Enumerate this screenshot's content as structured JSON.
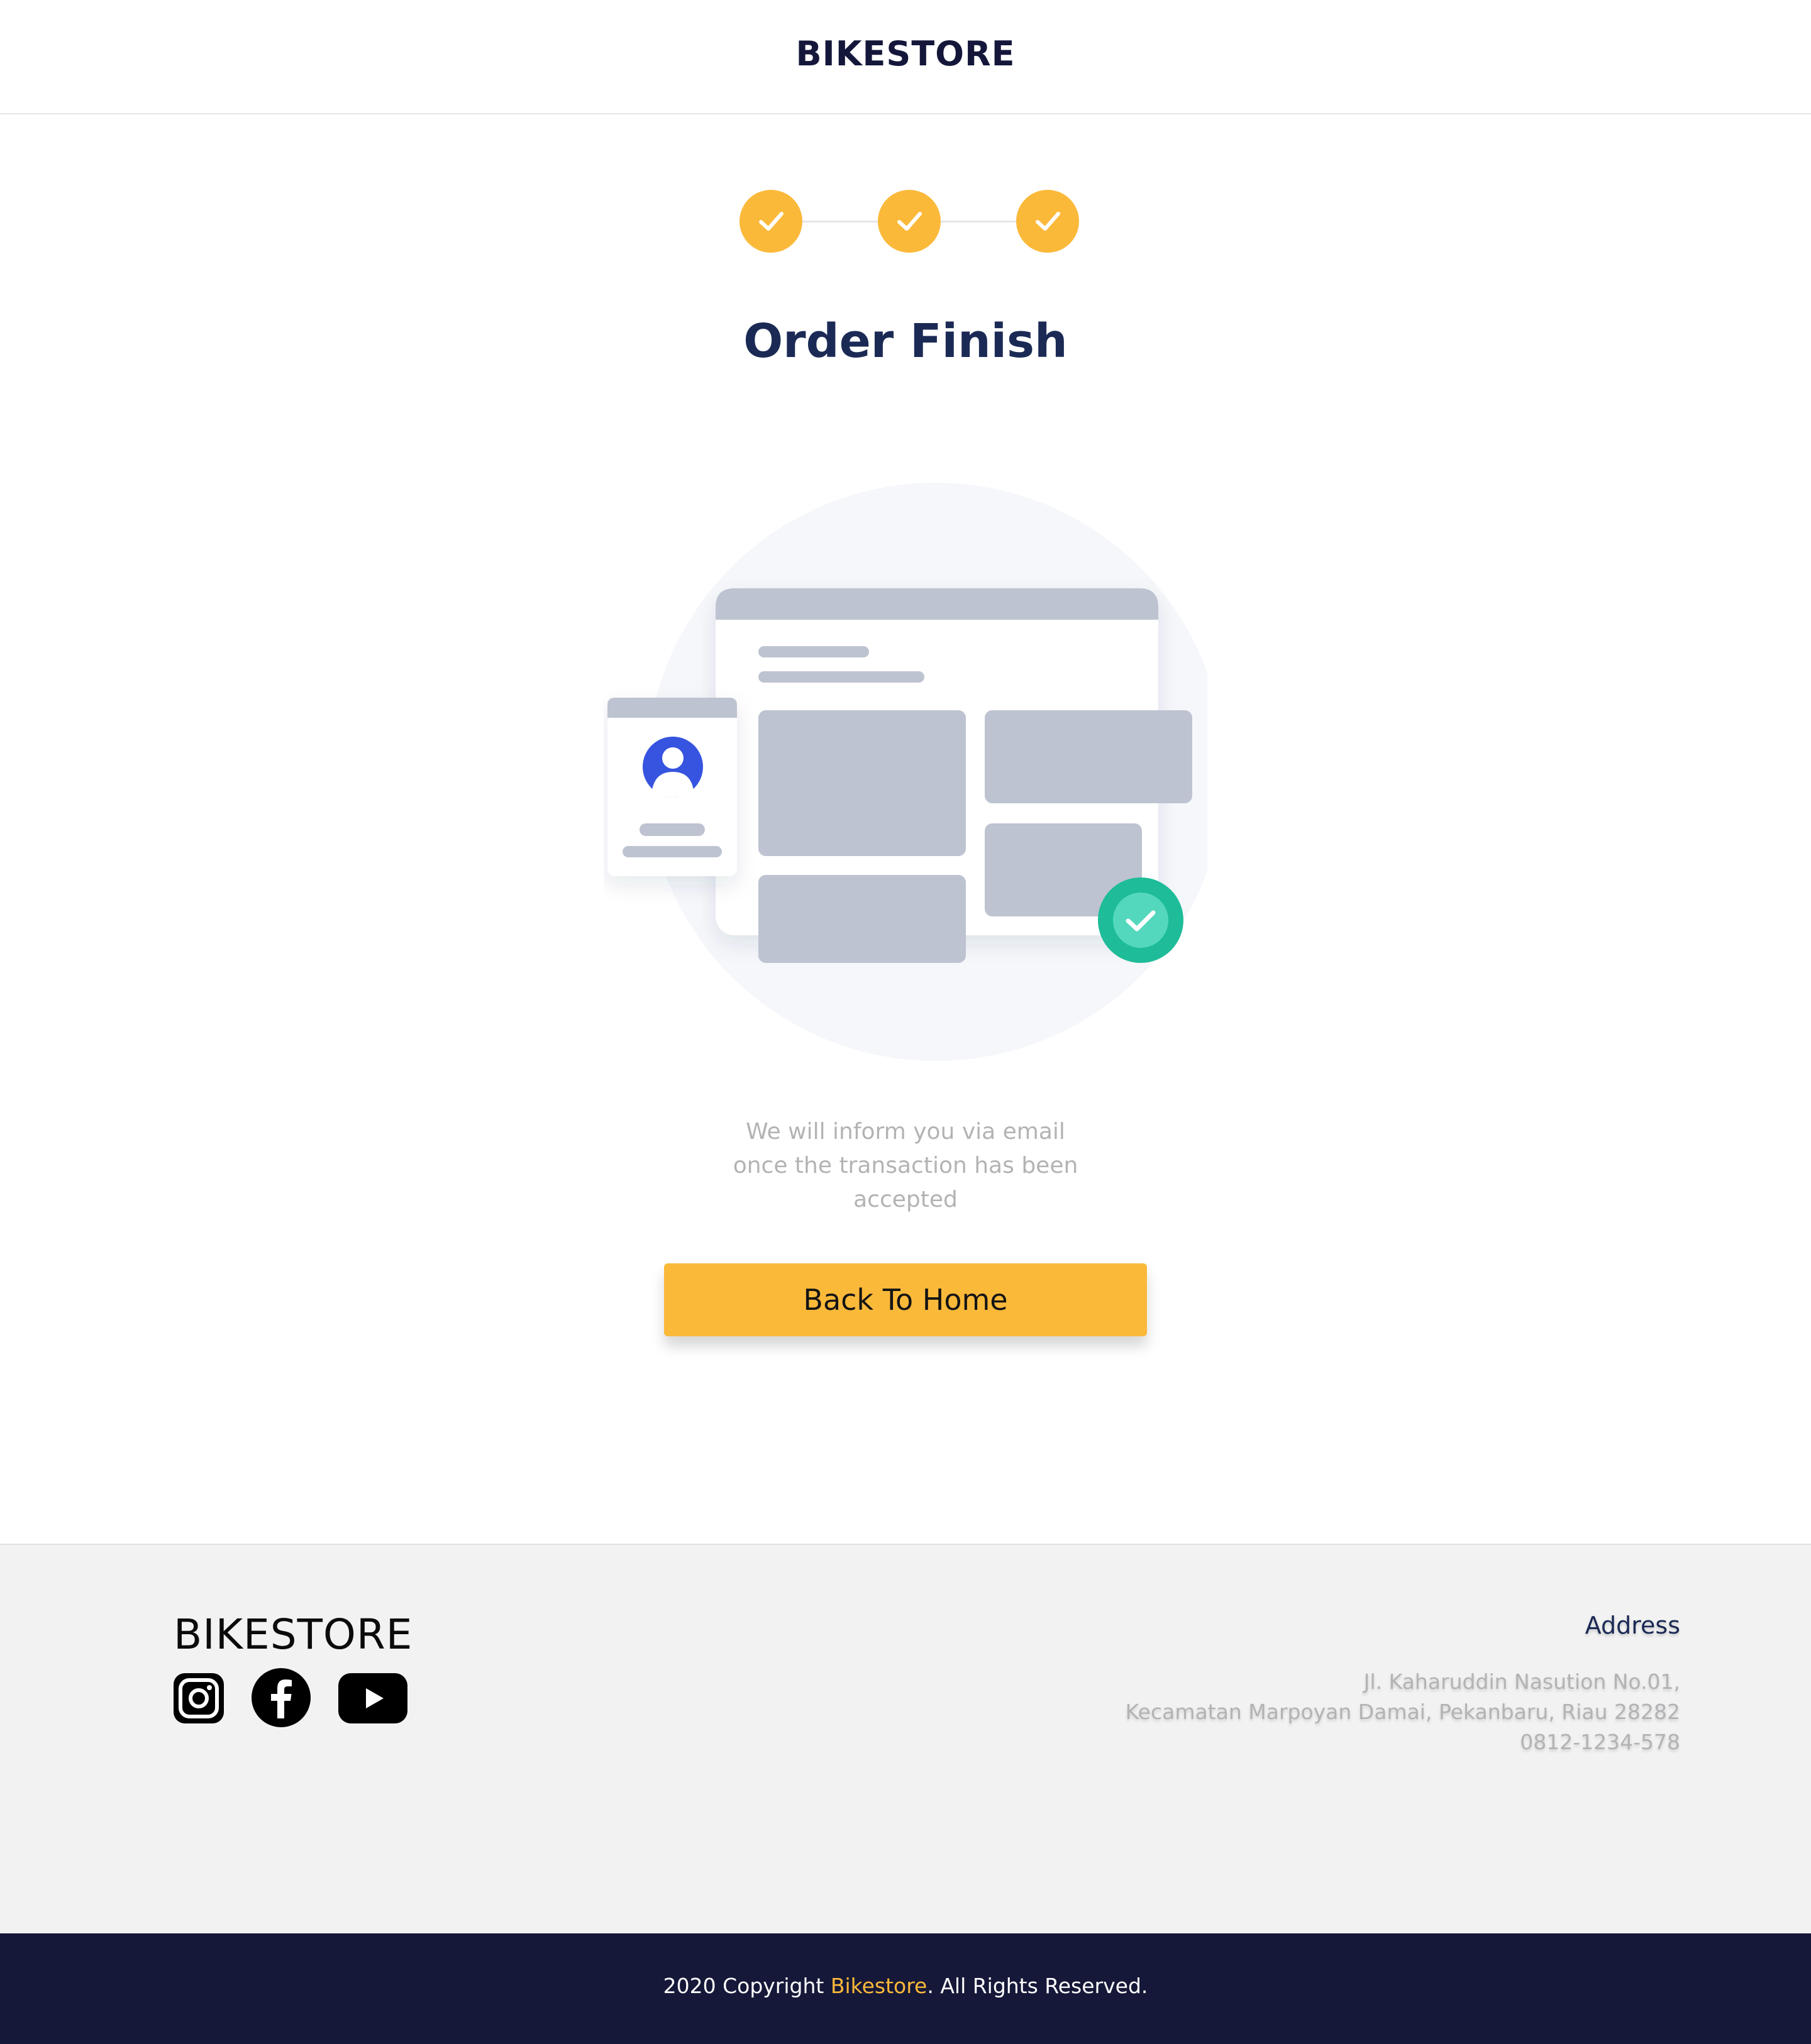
{
  "header": {
    "brand": "BIKESTORE"
  },
  "steps": [
    {
      "state": "done",
      "icon": "check-icon"
    },
    {
      "state": "done",
      "icon": "check-icon"
    },
    {
      "state": "done",
      "icon": "check-icon"
    }
  ],
  "main": {
    "title": "Order Finish",
    "message_lines": [
      "We will inform you via email",
      "once the transaction has been",
      "accepted"
    ],
    "back_button_label": "Back To Home",
    "illustration_icons": [
      "browser-window-icon",
      "user-card-icon",
      "success-check-icon"
    ]
  },
  "footer": {
    "brand": "BIKESTORE",
    "social_icons": [
      "instagram-icon",
      "facebook-icon",
      "youtube-icon"
    ],
    "address_title": "Address",
    "address_lines": [
      "Jl. Kaharuddin Nasution No.01,",
      "Kecamatan Marpoyan Damai, Pekanbaru, Riau 28282",
      "0812-1234-578"
    ]
  },
  "bottom_bar": {
    "copyright_prefix": "2020 Copyright ",
    "copyright_brand": "Bikestore",
    "copyright_suffix": ". All Rights Reserved."
  },
  "colors": {
    "accent": "#fbb93a",
    "title": "#1b2a55",
    "dark_bar": "#151838",
    "success": "#1ebc99"
  }
}
